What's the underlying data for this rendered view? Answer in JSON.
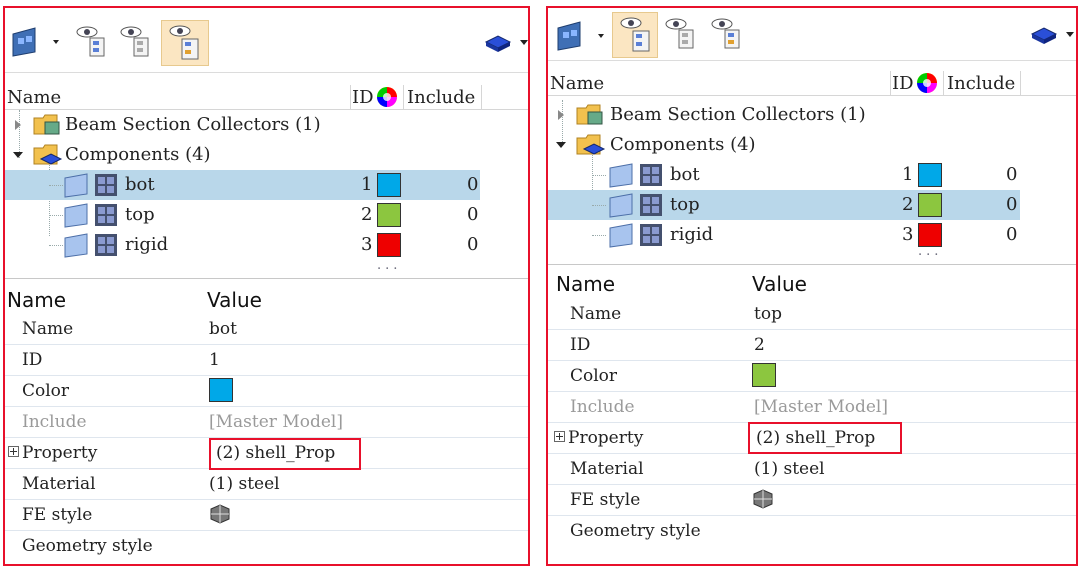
{
  "colors": {
    "frame_red": "#e8102b",
    "selection": "#b9d7ea",
    "blue": "#00a8e8",
    "green": "#8cc63f",
    "red": "#ee0000"
  },
  "tree_header": {
    "name": "Name",
    "id": "ID",
    "include": "Include"
  },
  "tree": {
    "beam_collectors": "Beam Section Collectors (1)",
    "components": "Components (4)",
    "items": [
      {
        "name": "bot",
        "id": "1",
        "include": "0",
        "color": "#00a8e8"
      },
      {
        "name": "top",
        "id": "2",
        "include": "0",
        "color": "#8cc63f"
      },
      {
        "name": "rigid",
        "id": "3",
        "include": "0",
        "color": "#ee0000"
      }
    ]
  },
  "icons": [
    "component-view-icon",
    "show-icon",
    "hide-icon",
    "isolate-icon",
    "display-mode-icon",
    "color-wheel-icon"
  ],
  "prop_header": {
    "name": "Name",
    "value": "Value"
  },
  "prop_labels": {
    "name": "Name",
    "id": "ID",
    "color": "Color",
    "include": "Include",
    "property": "Property",
    "material": "Material",
    "fe_style": "FE style",
    "geometry_style": "Geometry style"
  },
  "panel_left": {
    "selected_name": "bot",
    "selected_id": "1",
    "selected_color": "#00a8e8",
    "include": "[Master Model]",
    "property": "(2) shell_Prop",
    "material": "(1) steel"
  },
  "panel_right": {
    "selected_name": "top",
    "selected_id": "2",
    "selected_color": "#8cc63f",
    "include": "[Master Model]",
    "property": "(2) shell_Prop",
    "material": "(1) steel"
  },
  "dots": "..."
}
